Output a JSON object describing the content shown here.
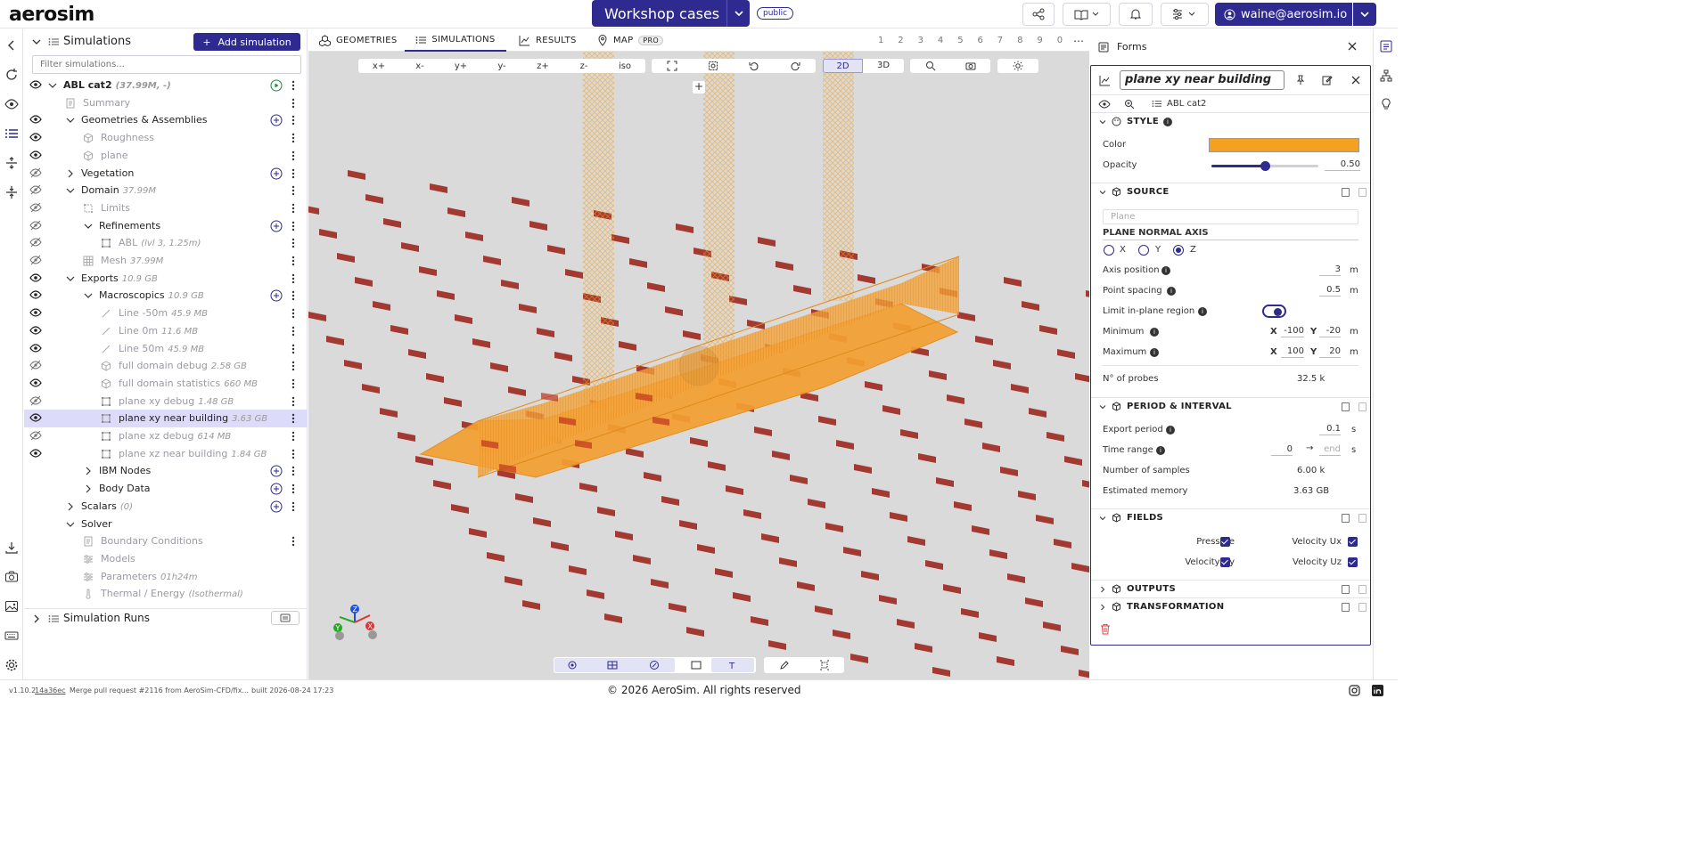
{
  "app": {
    "logo": "aerosim",
    "project_title": "Workshop cases",
    "visibility_badge": "public",
    "user_email": "waine@aerosim.io"
  },
  "tree": {
    "title": "Simulations",
    "add_label": "Add simulation",
    "filter_placeholder": "Filter simulations...",
    "rows": [
      {
        "label": "ABL cat2",
        "meta": "(37.99M, -)"
      },
      {
        "label": "Summary",
        "meta": ""
      },
      {
        "label": "Geometries & Assemblies",
        "meta": ""
      },
      {
        "label": "Roughness",
        "meta": ""
      },
      {
        "label": "plane",
        "meta": ""
      },
      {
        "label": "Vegetation",
        "meta": ""
      },
      {
        "label": "Domain",
        "meta": "37.99M"
      },
      {
        "label": "Limits",
        "meta": ""
      },
      {
        "label": "Refinements",
        "meta": ""
      },
      {
        "label": "ABL",
        "meta": "(lvl 3, 1.25m)"
      },
      {
        "label": "Mesh",
        "meta": "37.99M"
      },
      {
        "label": "Exports",
        "meta": "10.9 GB"
      },
      {
        "label": "Macroscopics",
        "meta": "10.9 GB"
      },
      {
        "label": "Line -50m",
        "meta": "45.9 MB"
      },
      {
        "label": "Line 0m",
        "meta": "11.6 MB"
      },
      {
        "label": "Line 50m",
        "meta": "45.9 MB"
      },
      {
        "label": "full domain debug",
        "meta": "2.58 GB"
      },
      {
        "label": "full domain statistics",
        "meta": "660 MB"
      },
      {
        "label": "plane xy debug",
        "meta": "1.48 GB"
      },
      {
        "label": "plane xy near building",
        "meta": "3.63 GB"
      },
      {
        "label": "plane xz debug",
        "meta": "614 MB"
      },
      {
        "label": "plane xz near building",
        "meta": "1.84 GB"
      },
      {
        "label": "IBM Nodes",
        "meta": ""
      },
      {
        "label": "Body Data",
        "meta": ""
      },
      {
        "label": "Scalars",
        "meta": "(0)"
      },
      {
        "label": "Solver",
        "meta": ""
      },
      {
        "label": "Boundary Conditions",
        "meta": ""
      },
      {
        "label": "Models",
        "meta": ""
      },
      {
        "label": "Parameters",
        "meta": "01h24m"
      },
      {
        "label": "Thermal / Energy",
        "meta": "(Isothermal)"
      }
    ],
    "sim_runs": "Simulation Runs"
  },
  "viewport": {
    "tabs": [
      "GEOMETRIES",
      "SIMULATIONS",
      "RESULTS",
      "MAP"
    ],
    "pro_badge": "PRO",
    "numbers": [
      "1",
      "2",
      "3",
      "4",
      "5",
      "6",
      "7",
      "8",
      "9",
      "0"
    ],
    "views": [
      "x+",
      "x-",
      "y+",
      "y-",
      "z+",
      "z-",
      "iso"
    ],
    "mode_2d": "2D",
    "mode_3d": "3D"
  },
  "forms": {
    "title": "Forms",
    "name": "plane xy near building",
    "parent": "ABL cat2",
    "style": {
      "title": "STYLE",
      "color_label": "Color",
      "color": "#f5a01e",
      "opacity_label": "Opacity",
      "opacity": "0.50"
    },
    "source": {
      "title": "SOURCE",
      "type": "Plane",
      "normal_axis_title": "PLANE NORMAL AXIS",
      "axes": [
        "X",
        "Y",
        "Z"
      ],
      "selected_axis": "Z",
      "axis_position_label": "Axis position",
      "axis_position": "3",
      "point_spacing_label": "Point spacing",
      "point_spacing": "0.5",
      "limit_label": "Limit in-plane region",
      "minimum_label": "Minimum",
      "min_x": "-100",
      "min_y": "-20",
      "maximum_label": "Maximum",
      "max_x": "100",
      "max_y": "20",
      "probes_label": "N° of probes",
      "probes": "32.5 k",
      "unit_m": "m",
      "x": "X",
      "y": "Y"
    },
    "period": {
      "title": "PERIOD & INTERVAL",
      "export_label": "Export period",
      "export": "0.1",
      "unit_s": "s",
      "time_label": "Time range",
      "time_start": "0",
      "time_end": "end",
      "samples_label": "Number of samples",
      "samples": "6.00 k",
      "memory_label": "Estimated memory",
      "memory": "3.63 GB"
    },
    "fields": {
      "title": "FIELDS",
      "items": [
        "Pressure",
        "Velocity Ux",
        "Velocity Uy",
        "Velocity Uz"
      ]
    },
    "outputs": "OUTPUTS",
    "transformation": "TRANSFORMATION"
  },
  "footer": {
    "version": "v1.10.2",
    "commit": "14a36ec",
    "message": "Merge pull request #2116 from AeroSim-CFD/fix...",
    "built": "built 2026-08-24 17:23",
    "copyright": "© 2026 AeroSim. All rights reserved"
  },
  "colors": {
    "accent": "#2e2a8f",
    "plane": "#f5a01e",
    "obstacle": "#a33a32"
  }
}
